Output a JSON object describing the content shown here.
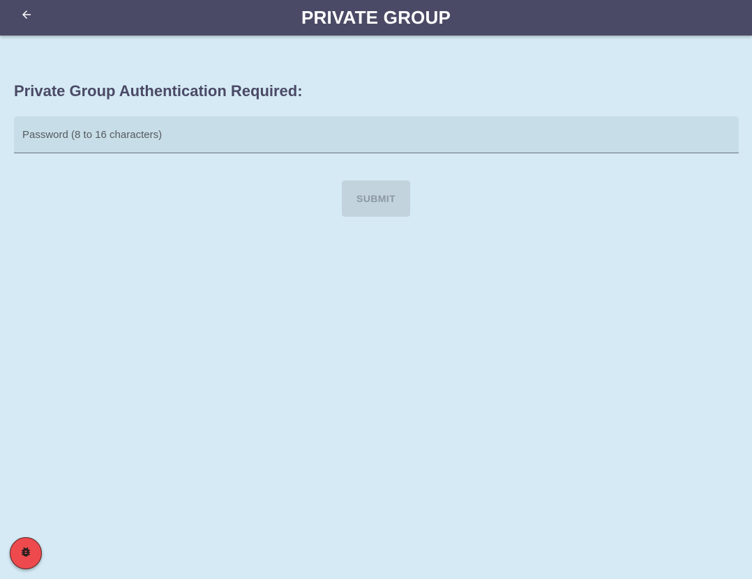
{
  "app_bar": {
    "title": "PRIVATE GROUP",
    "back_icon": "arrow-left-icon",
    "background": "#4b4a66"
  },
  "auth": {
    "heading": "Private Group Authentication Required:",
    "password_placeholder": "Password (8 to 16 characters)",
    "password_value": "",
    "submit_label": "SUBMIT"
  },
  "debug_button": {
    "icon": "bug-icon",
    "color": "#ee4a4d"
  },
  "colors": {
    "page_background": "#d5eaf5",
    "heading": "#4b4a66",
    "field_background": "#c7dde7",
    "submit_disabled": "#c3d3dd"
  }
}
